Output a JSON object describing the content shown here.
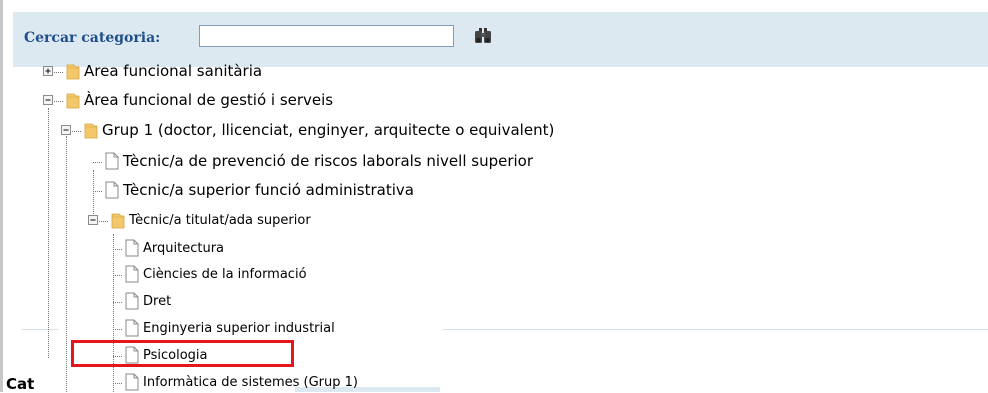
{
  "search": {
    "label": "Cercar categoria:",
    "value": "",
    "placeholder": ""
  },
  "tree": {
    "n0": {
      "label": "Area funcional sanitària",
      "state": "collapsed"
    },
    "n1": {
      "label": "Àrea funcional de gestió i serveis",
      "state": "expanded"
    },
    "n2": {
      "label": "Grup 1 (doctor, llicenciat, enginyer, arquitecte o equivalent)",
      "state": "expanded"
    },
    "n3": {
      "label": "Tècnic/a de prevenció de riscos laborals nivell superior"
    },
    "n4": {
      "label": "Tècnic/a superior funció administrativa"
    },
    "n5": {
      "label": "Tècnic/a titulat/ada superior",
      "state": "expanded"
    },
    "n6": {
      "label": "Arquitectura"
    },
    "n7": {
      "label": "Ciències de la informació"
    },
    "n8": {
      "label": "Dret"
    },
    "n9": {
      "label": "Enginyeria superior industrial"
    },
    "n10": {
      "label": "Psicologia",
      "highlighted": true
    },
    "n11": {
      "label": "Informàtica de sistemes (Grup 1)"
    }
  },
  "background": {
    "cat_label": "Cat"
  },
  "colors": {
    "search_bar_bg": "#dde9f1",
    "search_label": "#1f4f8a",
    "folder": "#f2c86a",
    "highlight_box": "#e3161c"
  }
}
